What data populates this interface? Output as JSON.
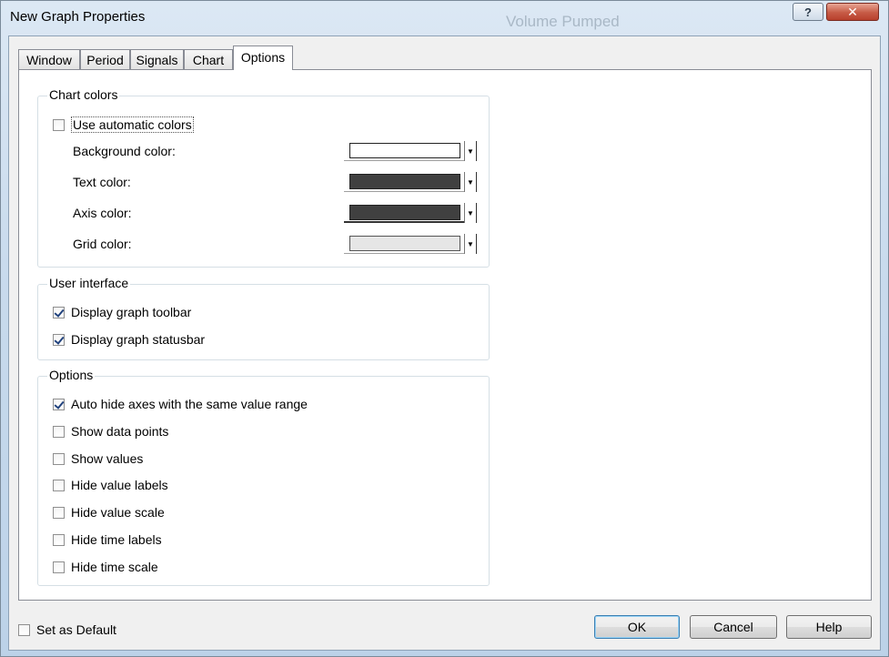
{
  "window": {
    "title": "New Graph Properties",
    "background_title": "Volume Pumped",
    "help_glyph": "?",
    "close_glyph": "✕"
  },
  "tabs": [
    {
      "label": "Window",
      "active": false
    },
    {
      "label": "Period",
      "active": false
    },
    {
      "label": "Signals",
      "active": false
    },
    {
      "label": "Chart",
      "active": false
    },
    {
      "label": "Options",
      "active": true
    }
  ],
  "chart_colors": {
    "group_label": "Chart colors",
    "use_automatic": {
      "label": "Use automatic colors",
      "checked": false
    },
    "rows": [
      {
        "label": "Background color:",
        "color": "#ffffff"
      },
      {
        "label": "Text color:",
        "color": "#404040"
      },
      {
        "label": "Axis color:",
        "color": "#404040"
      },
      {
        "label": "Grid color:",
        "color": "#e6e6e6"
      }
    ]
  },
  "user_interface": {
    "group_label": "User interface",
    "items": [
      {
        "label": "Display graph toolbar",
        "checked": true
      },
      {
        "label": "Display graph statusbar",
        "checked": true
      }
    ]
  },
  "options": {
    "group_label": "Options",
    "items": [
      {
        "label": "Auto hide axes with the same value range",
        "checked": true
      },
      {
        "label": "Show data points",
        "checked": false
      },
      {
        "label": "Show values",
        "checked": false
      },
      {
        "label": "Hide value labels",
        "checked": false
      },
      {
        "label": "Hide value scale",
        "checked": false
      },
      {
        "label": "Hide time labels",
        "checked": false
      },
      {
        "label": "Hide time scale",
        "checked": false
      }
    ]
  },
  "footer": {
    "set_default": {
      "label": "Set as Default",
      "checked": false
    },
    "ok_label": "OK",
    "cancel_label": "Cancel",
    "help_label": "Help"
  }
}
